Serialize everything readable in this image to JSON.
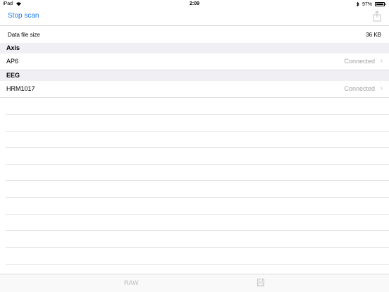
{
  "status_bar": {
    "device": "iPad",
    "time": "2:09",
    "battery": "97%"
  },
  "nav": {
    "left_button": "Stop scan"
  },
  "data_file": {
    "label": "Data file size",
    "value": "36 KB"
  },
  "sections": [
    {
      "title": "Axis",
      "device": "AP6",
      "status": "Connected"
    },
    {
      "title": "EEG",
      "device": "HRM1017",
      "status": "Connected"
    }
  ],
  "toolbar": {
    "raw_label": "RAW"
  },
  "colors": {
    "accent": "#1a7cf5",
    "section_bg": "#efeff4",
    "muted": "#a3a3a3"
  }
}
